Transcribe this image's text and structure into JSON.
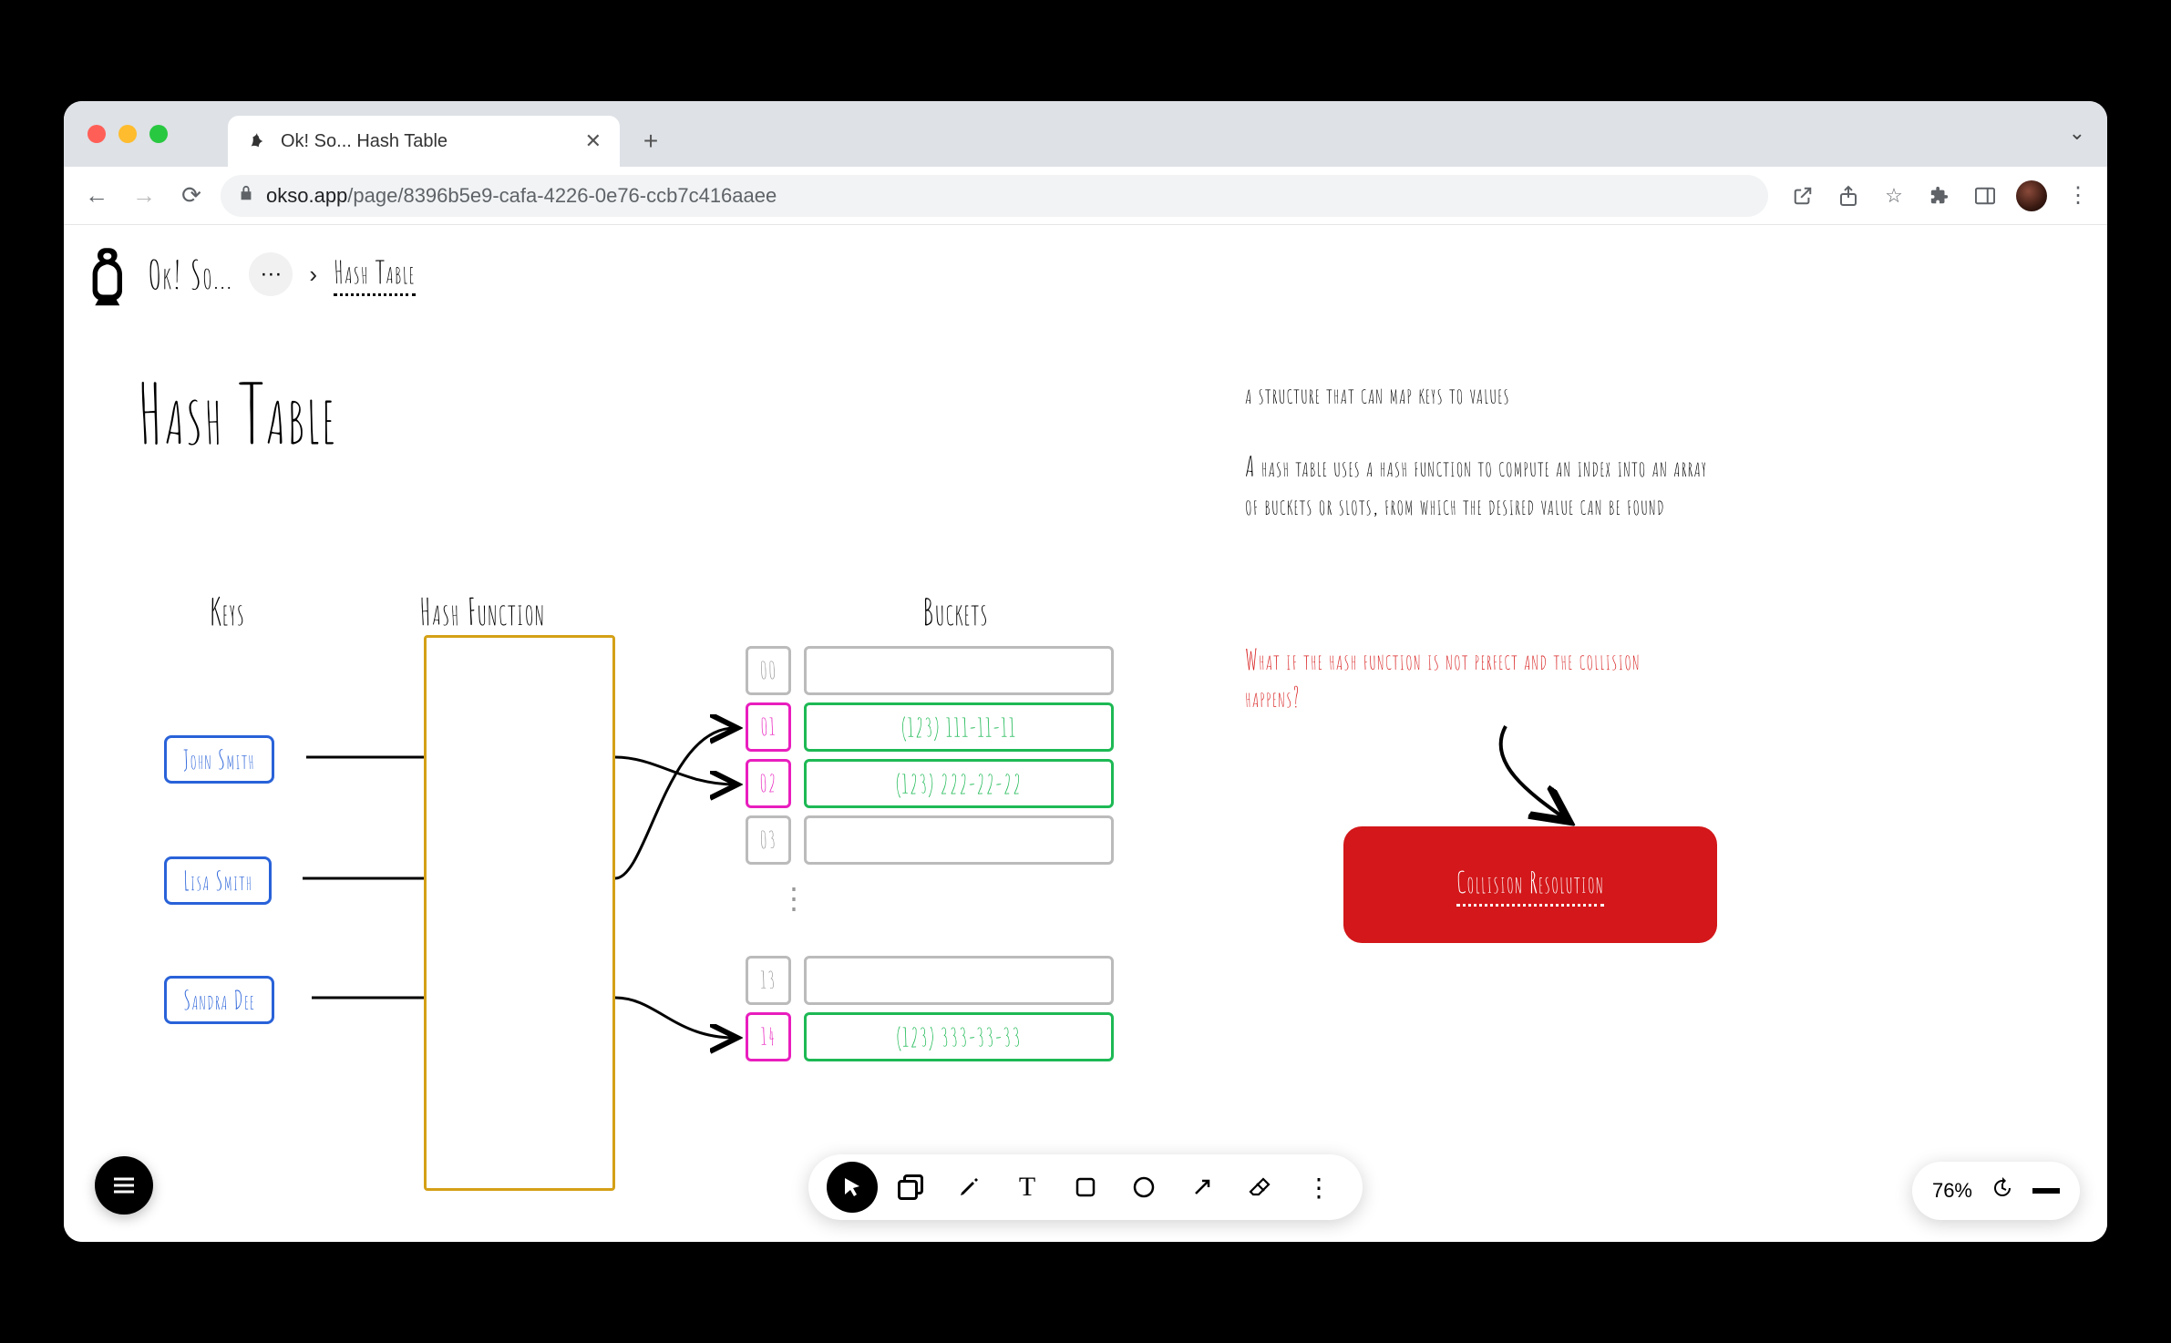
{
  "browser": {
    "tab_title": "Ok! So... Hash Table",
    "url_domain": "okso.app",
    "url_path": "/page/8396b5e9-cafa-4226-0e76-ccb7c416aaee"
  },
  "app": {
    "name": "Ok! So...",
    "breadcrumb_current": "Hash Table"
  },
  "canvas": {
    "title": "Hash Table",
    "labels": {
      "keys": "Keys",
      "hash_function": "Hash Function",
      "buckets": "Buckets"
    },
    "keys": [
      "John Smith",
      "Lisa Smith",
      "Sandra Dee"
    ],
    "buckets": [
      {
        "index": "00",
        "value": "",
        "active": false
      },
      {
        "index": "01",
        "value": "(123) 111-11-11",
        "active": true
      },
      {
        "index": "02",
        "value": "(123) 222-22-22",
        "active": true
      },
      {
        "index": "03",
        "value": "",
        "active": false
      },
      {
        "index": "13",
        "value": "",
        "active": false
      },
      {
        "index": "14",
        "value": "(123) 333-33-33",
        "active": true
      }
    ],
    "description_1": "a structure that can map keys to values",
    "description_2": "A hash table uses a hash function to compute an index into an array of buckets or slots, from which the desired value can be found",
    "question": "What if the hash function is not perfect and the collision happens?",
    "collision_button": "Collision Resolution"
  },
  "toolbar": {
    "zoom": "76%"
  }
}
